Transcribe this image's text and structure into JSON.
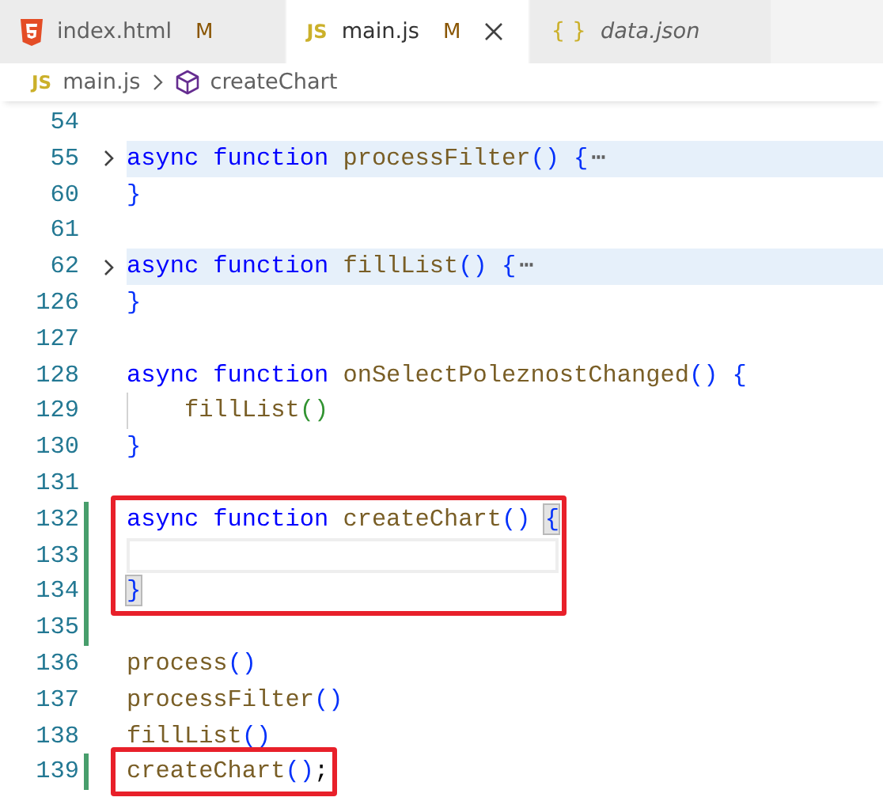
{
  "tabs": [
    {
      "label": "index.html",
      "kind": "html",
      "modified": "M",
      "selected": false,
      "preview": false,
      "closable": false
    },
    {
      "label": "main.js",
      "kind": "js",
      "icon_text": "JS",
      "modified": "M",
      "selected": true,
      "preview": false,
      "closable": true
    },
    {
      "label": "data.json",
      "kind": "json",
      "icon_text": "{ }",
      "selected": false,
      "preview": true,
      "closable": false
    }
  ],
  "breadcrumb": {
    "file_icon_text": "JS",
    "file": "main.js",
    "symbol": "createChart"
  },
  "groups": [
    {
      "boxed": false,
      "lines": [
        {
          "number": "54"
        },
        {
          "number": "55",
          "folded": true,
          "tokens": [
            {
              "text": "async function ",
              "kind": "keyword"
            },
            {
              "text": "processFilter",
              "kind": "function"
            },
            {
              "text": "() {",
              "kind": "bracket1"
            },
            {
              "text": "⋯",
              "kind": "ellipsis"
            }
          ]
        },
        {
          "number": "60",
          "tokens": [
            {
              "text": "}",
              "kind": "bracket1"
            }
          ]
        },
        {
          "number": "61"
        },
        {
          "number": "62",
          "folded": true,
          "tokens": [
            {
              "text": "async function ",
              "kind": "keyword"
            },
            {
              "text": "fillList",
              "kind": "function"
            },
            {
              "text": "() {",
              "kind": "bracket1"
            },
            {
              "text": "⋯",
              "kind": "ellipsis"
            }
          ]
        },
        {
          "number": "126",
          "tokens": [
            {
              "text": "}",
              "kind": "bracket1"
            }
          ]
        },
        {
          "number": "127"
        },
        {
          "number": "128",
          "tokens": [
            {
              "text": "async function ",
              "kind": "keyword"
            },
            {
              "text": "onSelectPoleznostChanged",
              "kind": "function"
            },
            {
              "text": "() {",
              "kind": "bracket1"
            }
          ]
        },
        {
          "number": "129",
          "indent_guide": true,
          "tokens": [
            {
              "text": "fillList",
              "kind": "function"
            },
            {
              "text": "()",
              "kind": "bracket2"
            }
          ]
        },
        {
          "number": "130",
          "tokens": [
            {
              "text": "}",
              "kind": "bracket1"
            }
          ]
        },
        {
          "number": "131"
        }
      ]
    },
    {
      "boxed": true,
      "lines": [
        {
          "number": "132",
          "git_added": true,
          "tokens": [
            {
              "text": "async function ",
              "kind": "keyword"
            },
            {
              "text": "createChart",
              "kind": "function"
            },
            {
              "text": "() ",
              "kind": "bracket1"
            },
            {
              "text": "{",
              "kind": "bracket-match"
            }
          ]
        },
        {
          "number": "133",
          "git_added": true,
          "current": true
        },
        {
          "number": "134",
          "git_added": true,
          "tokens": [
            {
              "text": "}",
              "kind": "bracket-match"
            }
          ]
        }
      ]
    },
    {
      "boxed": false,
      "lines": [
        {
          "number": "135",
          "git_added": true
        },
        {
          "number": "136",
          "tokens": [
            {
              "text": "process",
              "kind": "function"
            },
            {
              "text": "()",
              "kind": "bracket1"
            }
          ]
        },
        {
          "number": "137",
          "tokens": [
            {
              "text": "processFilter",
              "kind": "function"
            },
            {
              "text": "()",
              "kind": "bracket1"
            }
          ]
        },
        {
          "number": "138",
          "tokens": [
            {
              "text": "fillList",
              "kind": "function"
            },
            {
              "text": "()",
              "kind": "bracket1"
            }
          ]
        }
      ]
    },
    {
      "boxed": true,
      "lines": [
        {
          "number": "139",
          "git_added": true,
          "tokens": [
            {
              "text": "createChart",
              "kind": "function"
            },
            {
              "text": "()",
              "kind": "bracket1"
            },
            {
              "text": ";",
              "kind": "punctuation"
            }
          ]
        }
      ]
    }
  ]
}
